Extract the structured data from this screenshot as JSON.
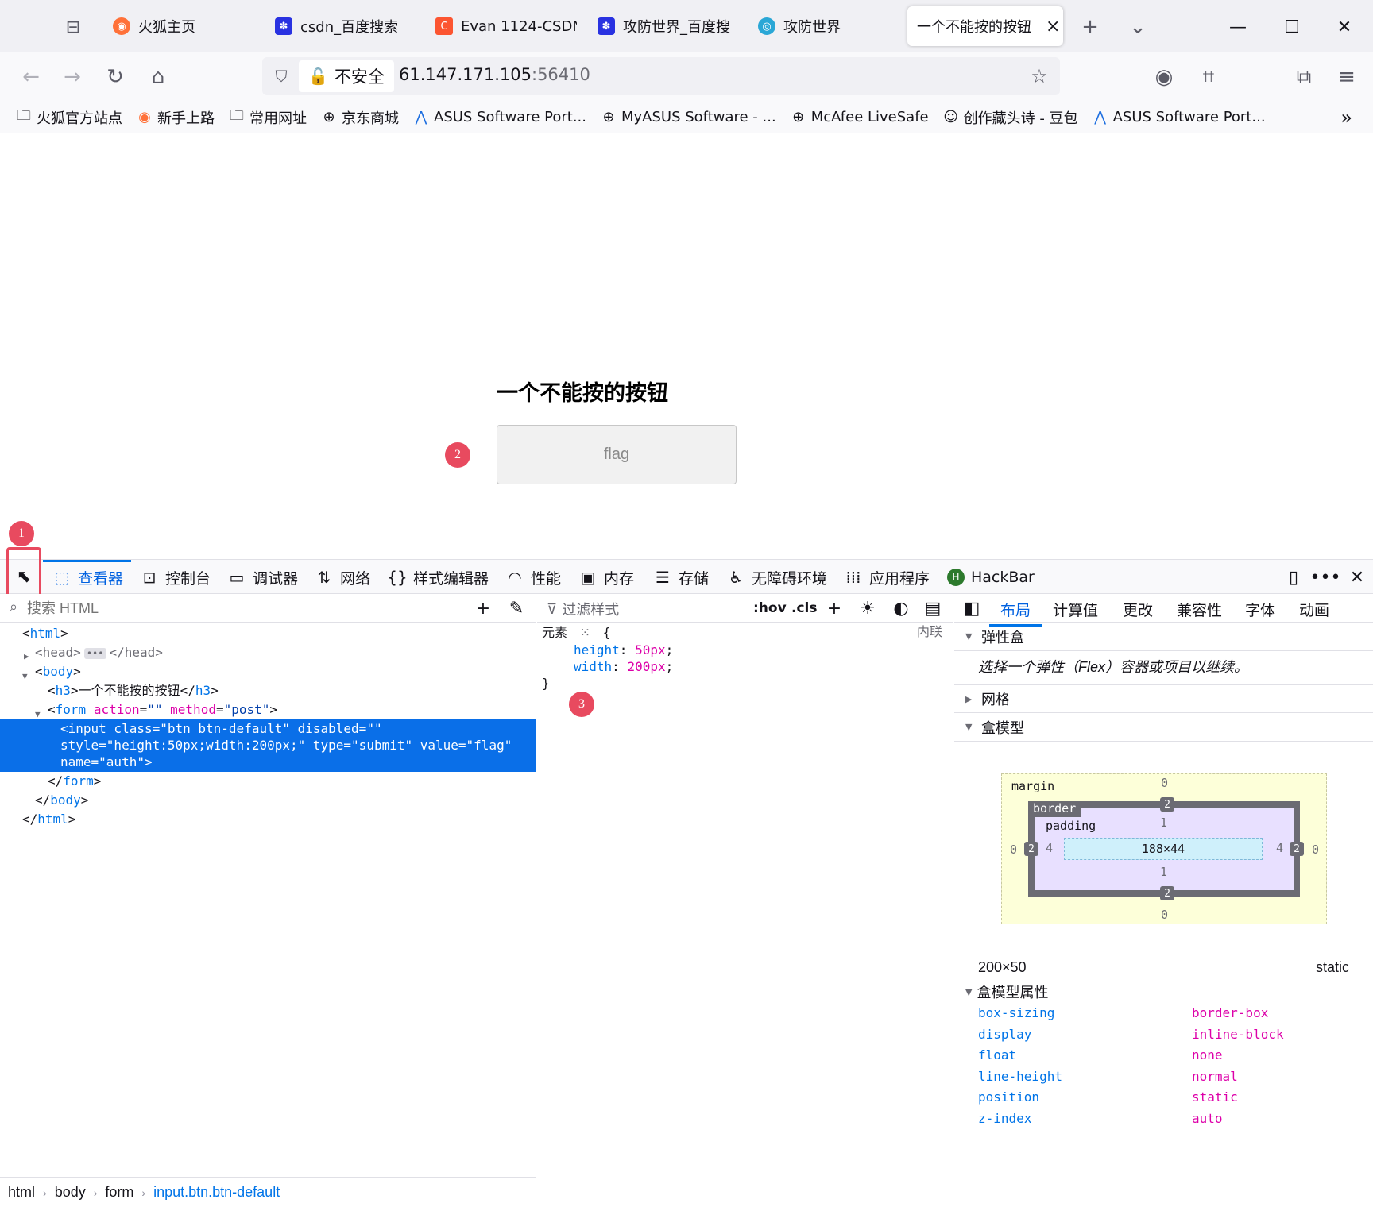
{
  "tabs": [
    {
      "title": "火狐主页",
      "icon": "firefox-icon"
    },
    {
      "title": "csdn_百度搜索",
      "icon": "baidu-paw-icon"
    },
    {
      "title": "Evan 1124-CSDN",
      "icon": "csdn-icon"
    },
    {
      "title": "攻防世界_百度搜",
      "icon": "baidu-paw-icon"
    },
    {
      "title": "攻防世界",
      "icon": "adworld-icon"
    },
    {
      "title": "一个不能按的按钮",
      "icon": "",
      "active": true
    }
  ],
  "nav": {
    "insecure_label": "不安全",
    "url_host": "61.147.171.105",
    "url_port": ":56410"
  },
  "bookmarks": [
    {
      "label": "火狐官方站点",
      "icon": "folder-icon"
    },
    {
      "label": "新手上路",
      "icon": "firefox-icon"
    },
    {
      "label": "常用网址",
      "icon": "folder-icon"
    },
    {
      "label": "京东商城",
      "icon": "globe-icon"
    },
    {
      "label": "ASUS Software Port...",
      "icon": "asus-icon"
    },
    {
      "label": "MyASUS Software - ...",
      "icon": "globe-icon"
    },
    {
      "label": "McAfee LiveSafe",
      "icon": "globe-icon"
    },
    {
      "label": "创作藏头诗 - 豆包",
      "icon": "doubao-icon"
    },
    {
      "label": "ASUS Software Port...",
      "icon": "asus-icon"
    }
  ],
  "page": {
    "heading": "一个不能按的按钮",
    "button_value": "flag"
  },
  "markers": [
    "1",
    "2",
    "3"
  ],
  "devtools": {
    "tabs": [
      {
        "label": "查看器",
        "icon": "inspector-icon",
        "active": true
      },
      {
        "label": "控制台",
        "icon": "console-icon"
      },
      {
        "label": "调试器",
        "icon": "debugger-icon"
      },
      {
        "label": "网络",
        "icon": "network-icon"
      },
      {
        "label": "样式编辑器",
        "icon": "style-editor-icon"
      },
      {
        "label": "性能",
        "icon": "performance-icon"
      },
      {
        "label": "内存",
        "icon": "memory-icon"
      },
      {
        "label": "存储",
        "icon": "storage-icon"
      },
      {
        "label": "无障碍环境",
        "icon": "accessibility-icon"
      },
      {
        "label": "应用程序",
        "icon": "application-icon"
      },
      {
        "label": "HackBar",
        "icon": "hackbar-icon"
      }
    ],
    "search_placeholder": "搜索 HTML",
    "tree": {
      "html_open": "html",
      "head": "head",
      "body": "body",
      "h3_text": "一个不能按的按钮",
      "form_action_attr": "action",
      "form_action_val": "\"\"",
      "form_method_attr": "method",
      "form_method_val": "\"post\"",
      "input_line1": "<input class=\"btn btn-default\" disabled=\"\"",
      "input_line2": "style=\"height:50px;width:200px;\" type=\"submit\" value=\"flag\"",
      "input_line3": "name=\"auth\">"
    },
    "breadcrumb": [
      "html",
      "body",
      "form",
      "input.btn.btn-default"
    ],
    "rules": {
      "filter_placeholder": "过滤样式",
      "hov": ":hov",
      "cls": ".cls",
      "selector": "元素",
      "inline": "内联",
      "declarations": [
        {
          "prop": "height",
          "value": "50px"
        },
        {
          "prop": "width",
          "value": "200px"
        }
      ]
    },
    "layout": {
      "tabs": [
        "布局",
        "计算值",
        "更改",
        "兼容性",
        "字体",
        "动画"
      ],
      "flexbox": "弹性盒",
      "flex_note": "选择一个弹性（Flex）容器或项目以继续。",
      "grid": "网格",
      "box_model": "盒模型",
      "margin_label": "margin",
      "border_label": "border",
      "padding_label": "padding",
      "margin": {
        "top": "0",
        "right": "0",
        "bottom": "0",
        "left": "0"
      },
      "border": {
        "top": "2",
        "right": "2",
        "bottom": "2",
        "left": "2"
      },
      "padding": {
        "top": "1",
        "right": "4",
        "bottom": "1",
        "left": "4"
      },
      "content_size": "188×44",
      "element_size": "200×50",
      "position": "static",
      "props_title": "盒模型属性",
      "props": [
        {
          "key": "box-sizing",
          "value": "border-box"
        },
        {
          "key": "display",
          "value": "inline-block"
        },
        {
          "key": "float",
          "value": "none"
        },
        {
          "key": "line-height",
          "value": "normal"
        },
        {
          "key": "position",
          "value": "static"
        },
        {
          "key": "z-index",
          "value": "auto"
        }
      ]
    }
  }
}
